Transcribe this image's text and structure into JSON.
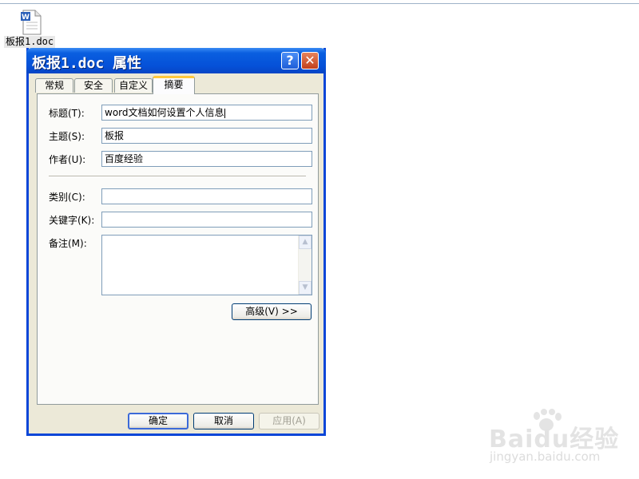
{
  "desktop": {
    "file_icon": "word-document-icon",
    "file_name": "板报1.doc"
  },
  "dialog": {
    "title": "板报1.doc 属性",
    "help_icon": "help-icon",
    "close_icon": "close-icon",
    "help_glyph": "?",
    "close_glyph": "✕",
    "tabs": [
      {
        "label": "常规",
        "active": false
      },
      {
        "label": "安全",
        "active": false
      },
      {
        "label": "自定义",
        "active": false
      },
      {
        "label": "摘要",
        "active": true
      }
    ],
    "fields": {
      "title": {
        "label": "标题(T):",
        "value": "word文档如何设置个人信息"
      },
      "subject": {
        "label": "主题(S):",
        "value": "板报"
      },
      "author": {
        "label": "作者(U):",
        "value": "百度经验"
      },
      "category": {
        "label": "类别(C):",
        "value": ""
      },
      "keywords": {
        "label": "关键字(K):",
        "value": ""
      },
      "comments": {
        "label": "备注(M):",
        "value": ""
      }
    },
    "advanced_button": "高级(V) >>",
    "ok_button": "确定",
    "cancel_button": "取消",
    "apply_button": "应用(A)"
  },
  "watermark": {
    "logo": "Baidu经验",
    "url": "jingyan.baidu.com"
  },
  "colors": {
    "titlebar": "#0551d8",
    "dialog_bg": "#ece9d8",
    "active_tab_accent": "#ffc83c",
    "close_button": "#c2401c"
  }
}
